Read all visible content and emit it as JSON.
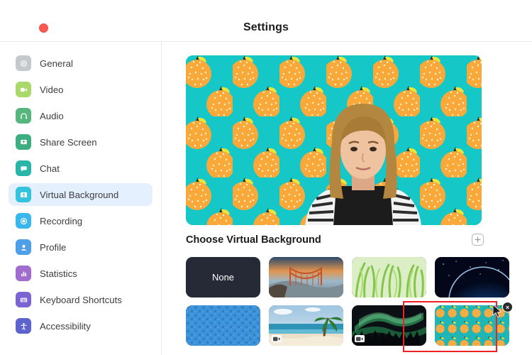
{
  "window": {
    "title": "Settings",
    "close_dot_color": "#f8584f"
  },
  "sidebar": {
    "items": [
      {
        "label": "General",
        "icon": "gear-icon",
        "color": "#c6c9cc",
        "active": false
      },
      {
        "label": "Video",
        "icon": "video-icon",
        "color": "#a9d96a",
        "active": false
      },
      {
        "label": "Audio",
        "icon": "headphones-icon",
        "color": "#57b67e",
        "active": false
      },
      {
        "label": "Share Screen",
        "icon": "share-screen-icon",
        "color": "#3cae81",
        "active": false
      },
      {
        "label": "Chat",
        "icon": "chat-icon",
        "color": "#2ab5a9",
        "active": false
      },
      {
        "label": "Virtual Background",
        "icon": "person-card-icon",
        "color": "#33c3dd",
        "active": true
      },
      {
        "label": "Recording",
        "icon": "record-icon",
        "color": "#3ab6ef",
        "active": false
      },
      {
        "label": "Profile",
        "icon": "profile-icon",
        "color": "#4f9ee8",
        "active": false
      },
      {
        "label": "Statistics",
        "icon": "statistics-icon",
        "color": "#a06cce",
        "active": false
      },
      {
        "label": "Keyboard Shortcuts",
        "icon": "keyboard-icon",
        "color": "#7c63d4",
        "active": false
      },
      {
        "label": "Accessibility",
        "icon": "accessibility-icon",
        "color": "#5d63cc",
        "active": false
      }
    ],
    "active_highlight_color": "#e4f0fd"
  },
  "preview": {
    "background_name": "orange-pattern",
    "bg_color": "#16c7c7",
    "fruit_color": "#f9a93a",
    "leaf_color": "#e8e63c",
    "stem_color": "#333027"
  },
  "section": {
    "title": "Choose Virtual Background",
    "add_button_label": "+"
  },
  "backgrounds": [
    {
      "name": "None",
      "type": "none",
      "video": false,
      "selected": false
    },
    {
      "name": "Golden Gate Bridge",
      "type": "image",
      "video": false,
      "selected": false
    },
    {
      "name": "Grass",
      "type": "image",
      "video": false,
      "selected": false
    },
    {
      "name": "Earth from Space",
      "type": "image",
      "video": false,
      "selected": false
    },
    {
      "name": "Blue Pattern",
      "type": "image",
      "video": false,
      "selected": false
    },
    {
      "name": "Beach",
      "type": "video",
      "video": true,
      "selected": false
    },
    {
      "name": "Aurora",
      "type": "video",
      "video": true,
      "selected": false
    },
    {
      "name": "Orange Pattern",
      "type": "image",
      "video": false,
      "selected": true,
      "remove_label": "×"
    }
  ],
  "annotation": {
    "color": "#ee2222",
    "target": "Orange Pattern"
  }
}
